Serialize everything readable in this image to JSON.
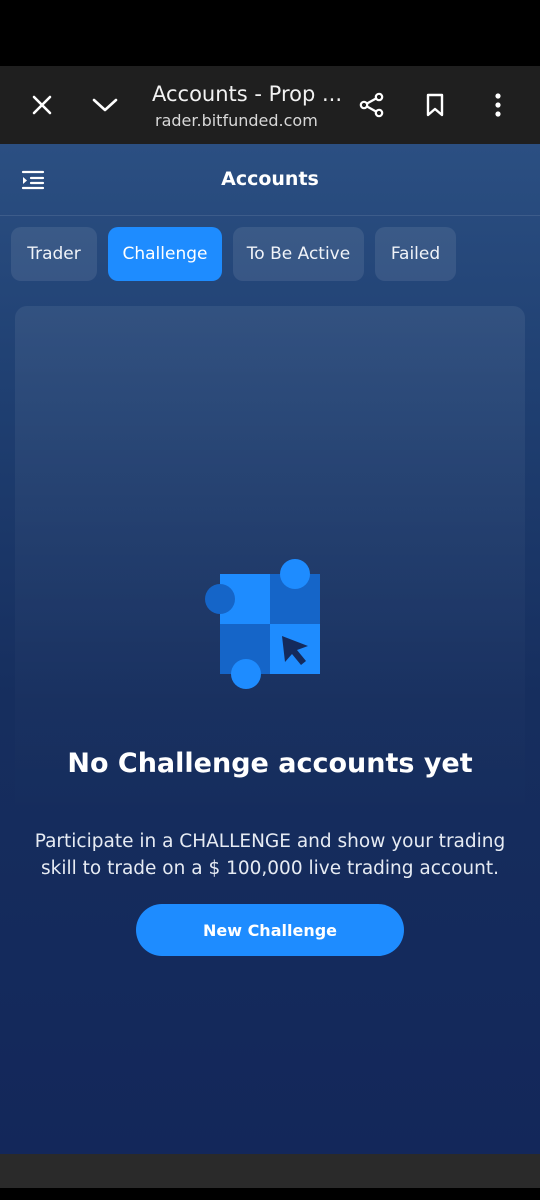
{
  "browser": {
    "title": "Accounts - Prop ...",
    "url": "rader.bitfunded.com"
  },
  "app": {
    "title": "Accounts"
  },
  "tabs": [
    {
      "label": "Trader",
      "active": false
    },
    {
      "label": "Challenge",
      "active": true
    },
    {
      "label": "To Be Active",
      "active": false
    },
    {
      "label": "Failed",
      "active": false
    }
  ],
  "empty_state": {
    "title": "No Challenge accounts yet",
    "description_line1": "Participate in a CHALLENGE and show your trading",
    "description_line2": "skill to trade on a $ 100,000 live trading account.",
    "button_label": "New Challenge"
  },
  "icons": {
    "close": "close-icon",
    "collapse": "chevron-down-icon",
    "share": "share-icon",
    "bookmark": "bookmark-icon",
    "more": "more-vert-icon",
    "menu": "menu-indent-icon"
  },
  "colors": {
    "accent": "#1e8cff",
    "browser_bar": "#1f1f1f",
    "app_background_top": "#2b4f82",
    "app_background_bottom": "#13275a"
  }
}
